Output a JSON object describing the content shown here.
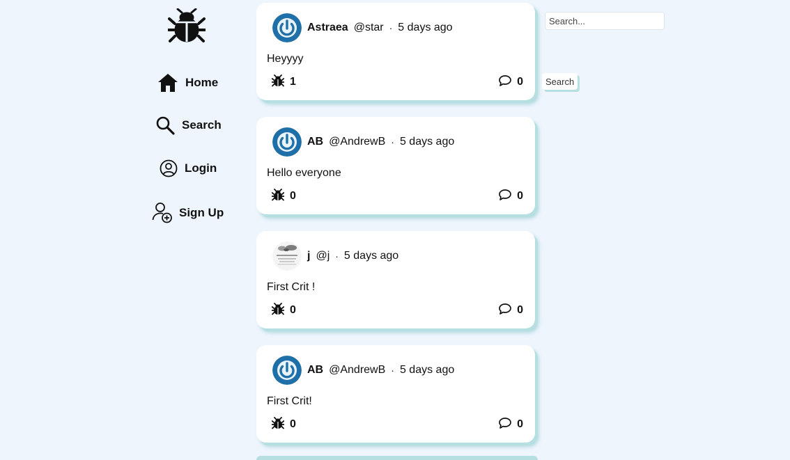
{
  "sidebar": {
    "logo_icon": "bug-icon",
    "items": [
      {
        "label": "Home",
        "icon": "home-icon"
      },
      {
        "label": "Search",
        "icon": "search-icon"
      },
      {
        "label": "Login",
        "icon": "user-circle-icon"
      },
      {
        "label": "Sign Up",
        "icon": "user-add-icon"
      }
    ]
  },
  "posts": [
    {
      "display_name": "Astraea",
      "handle": "@star",
      "timestamp": "5 days ago",
      "body": "Heyyyy",
      "bug_count": "1",
      "comment_count": "0",
      "avatar": "power-icon"
    },
    {
      "display_name": "AB",
      "handle": "@AndrewB",
      "timestamp": "5 days ago",
      "body": "Hello everyone",
      "bug_count": "0",
      "comment_count": "0",
      "avatar": "power-icon"
    },
    {
      "display_name": "j",
      "handle": "@j",
      "timestamp": "5 days ago",
      "body": "First Crit !",
      "bug_count": "0",
      "comment_count": "0",
      "avatar": "photo"
    },
    {
      "display_name": "AB",
      "handle": "@AndrewB",
      "timestamp": "5 days ago",
      "body": "First Crit!",
      "bug_count": "0",
      "comment_count": "0",
      "avatar": "power-icon"
    }
  ],
  "separator": "·",
  "search": {
    "placeholder": "Search...",
    "button_label": "Search"
  },
  "colors": {
    "background": "#eef5fd",
    "card_shadow": "#b6dfe2",
    "avatar_blue": "#1f6fa8"
  }
}
